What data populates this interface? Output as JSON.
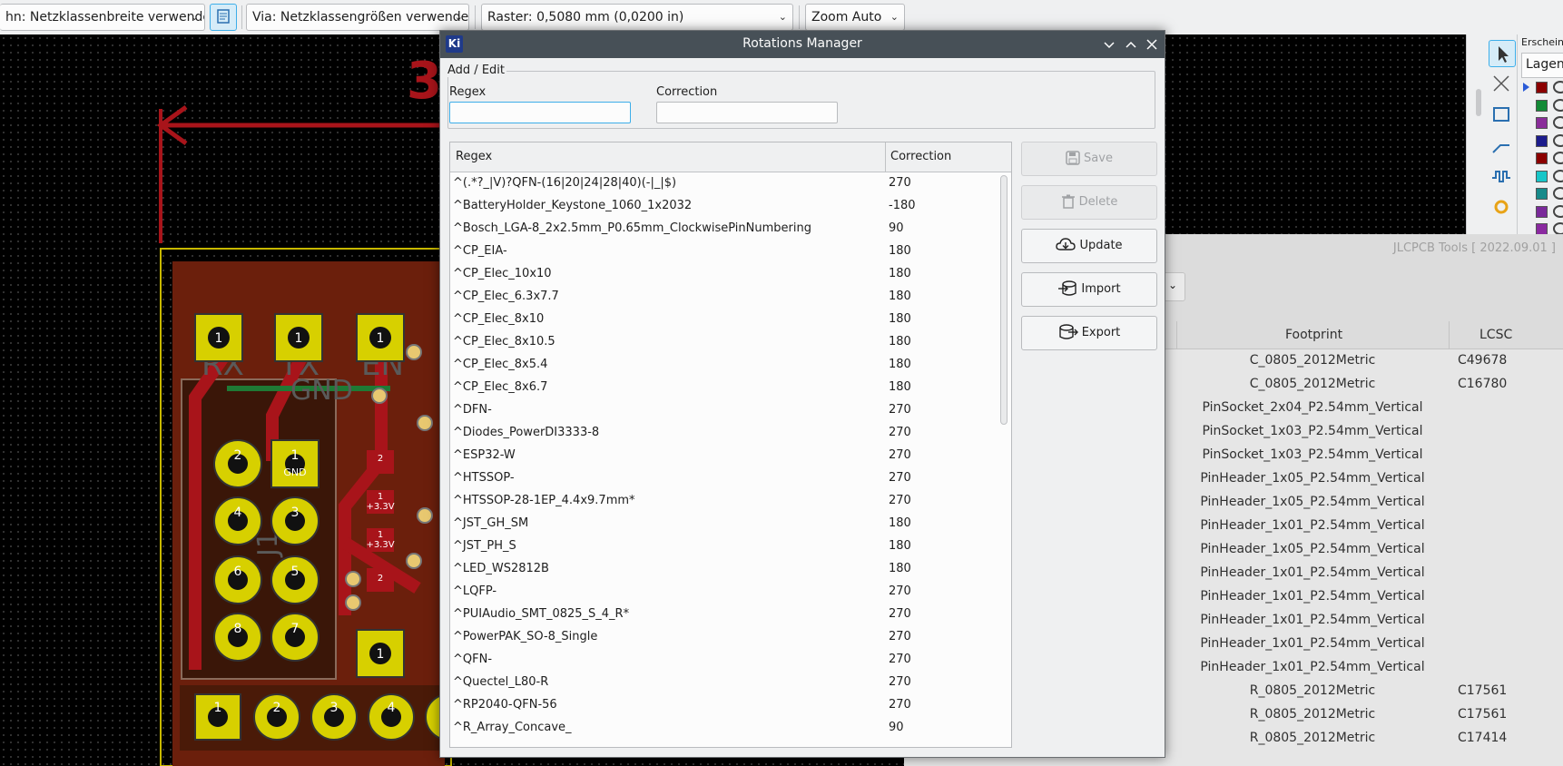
{
  "toolbar": {
    "track_width": "hn: Netzklassenbreite verwenden",
    "via_size": "Via: Netzklassengrößen verwenden",
    "grid": "Raster: 0,5080 mm (0,0200 in)",
    "zoom": "Zoom Auto"
  },
  "right_panel": {
    "appearance_tab": "Erscheinu",
    "layers_tab": "Lagen",
    "layer_colors": [
      "#8b0000",
      "#138a36",
      "#8a2d9a",
      "#1c1c8c",
      "#8b0000",
      "#18c6c8",
      "#178a8a",
      "#7a2a9a",
      "#8a2aa0"
    ]
  },
  "jlcpcb": {
    "title": "JLCPCB Tools [ 2022.09.01 ]",
    "columns": {
      "footprint": "Footprint",
      "lcsc": "LCSC"
    },
    "rows": [
      {
        "footprint": "C_0805_2012Metric",
        "lcsc": "C49678"
      },
      {
        "footprint": "C_0805_2012Metric",
        "lcsc": "C16780"
      },
      {
        "footprint": "PinSocket_2x04_P2.54mm_Vertical",
        "lcsc": ""
      },
      {
        "footprint": "PinSocket_1x03_P2.54mm_Vertical",
        "lcsc": ""
      },
      {
        "footprint": "PinSocket_1x03_P2.54mm_Vertical",
        "lcsc": ""
      },
      {
        "footprint": "PinHeader_1x05_P2.54mm_Vertical",
        "lcsc": ""
      },
      {
        "footprint": "PinHeader_1x05_P2.54mm_Vertical",
        "lcsc": ""
      },
      {
        "footprint": "PinHeader_1x01_P2.54mm_Vertical",
        "lcsc": ""
      },
      {
        "footprint": "PinHeader_1x05_P2.54mm_Vertical",
        "lcsc": ""
      },
      {
        "footprint": "PinHeader_1x01_P2.54mm_Vertical",
        "lcsc": ""
      },
      {
        "footprint": "PinHeader_1x01_P2.54mm_Vertical",
        "lcsc": ""
      },
      {
        "footprint": "PinHeader_1x01_P2.54mm_Vertical",
        "lcsc": ""
      },
      {
        "footprint": "PinHeader_1x01_P2.54mm_Vertical",
        "lcsc": ""
      },
      {
        "footprint": "PinHeader_1x01_P2.54mm_Vertical",
        "lcsc": ""
      },
      {
        "footprint": "R_0805_2012Metric",
        "lcsc": "C17561"
      },
      {
        "footprint": "R_0805_2012Metric",
        "lcsc": "C17561"
      },
      {
        "footprint": "R_0805_2012Metric",
        "lcsc": "C17414"
      }
    ]
  },
  "pcb": {
    "silk_labels": [
      "RX",
      "TX",
      "EN",
      "GND",
      "J1"
    ],
    "header_pins": [
      "2",
      "1",
      "4",
      "3",
      "6",
      "5",
      "8",
      "7"
    ],
    "gnd_label": "GND",
    "bottom_pins": [
      "1",
      "2",
      "3",
      "4"
    ],
    "pad_labels": [
      "2",
      "1",
      "+3.3V",
      "1",
      "+3.3V",
      "2"
    ]
  },
  "dialog": {
    "app_icon": "Ki",
    "title": "Rotations Manager",
    "group_title": "Add / Edit",
    "regex_label": "Regex",
    "correction_label": "Correction",
    "regex_value": "",
    "correction_value": "",
    "table_headers": {
      "regex": "Regex",
      "correction": "Correction"
    },
    "rows": [
      {
        "regex": "^(.*?_|V)?QFN-(16|20|24|28|40)(-|_|$)",
        "correction": "270"
      },
      {
        "regex": "^BatteryHolder_Keystone_1060_1x2032",
        "correction": "-180"
      },
      {
        "regex": "^Bosch_LGA-8_2x2.5mm_P0.65mm_ClockwisePinNumbering",
        "correction": "90"
      },
      {
        "regex": "^CP_EIA-",
        "correction": "180"
      },
      {
        "regex": "^CP_Elec_10x10",
        "correction": "180"
      },
      {
        "regex": "^CP_Elec_6.3x7.7",
        "correction": "180"
      },
      {
        "regex": "^CP_Elec_8x10",
        "correction": "180"
      },
      {
        "regex": "^CP_Elec_8x10.5",
        "correction": "180"
      },
      {
        "regex": "^CP_Elec_8x5.4",
        "correction": "180"
      },
      {
        "regex": "^CP_Elec_8x6.7",
        "correction": "180"
      },
      {
        "regex": "^DFN-",
        "correction": "270"
      },
      {
        "regex": "^Diodes_PowerDI3333-8",
        "correction": "270"
      },
      {
        "regex": "^ESP32-W",
        "correction": "270"
      },
      {
        "regex": "^HTSSOP-",
        "correction": "270"
      },
      {
        "regex": "^HTSSOP-28-1EP_4.4x9.7mm*",
        "correction": "270"
      },
      {
        "regex": "^JST_GH_SM",
        "correction": "180"
      },
      {
        "regex": "^JST_PH_S",
        "correction": "180"
      },
      {
        "regex": "^LED_WS2812B",
        "correction": "180"
      },
      {
        "regex": "^LQFP-",
        "correction": "270"
      },
      {
        "regex": "^PUIAudio_SMT_0825_S_4_R*",
        "correction": "270"
      },
      {
        "regex": "^PowerPAK_SO-8_Single",
        "correction": "270"
      },
      {
        "regex": "^QFN-",
        "correction": "270"
      },
      {
        "regex": "^Quectel_L80-R",
        "correction": "270"
      },
      {
        "regex": "^RP2040-QFN-56",
        "correction": "270"
      },
      {
        "regex": "^R_Array_Concave_",
        "correction": "90"
      }
    ],
    "buttons": {
      "save": "Save",
      "delete": "Delete",
      "update": "Update",
      "import": "Import",
      "export": "Export"
    }
  }
}
